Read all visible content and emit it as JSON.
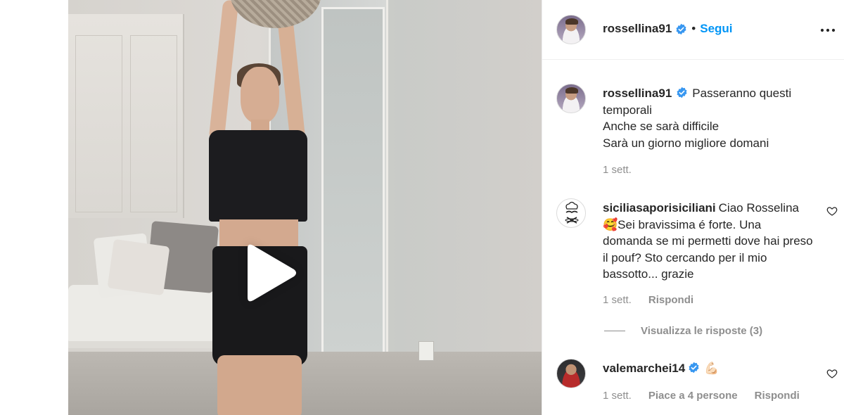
{
  "post": {
    "username": "rossellina91",
    "separator": "•",
    "follow_label": "Segui"
  },
  "caption": {
    "username": "rossellina91",
    "text_line1": "Passeranno questi temporali",
    "text_line2": "Anche se sarà difficile",
    "text_line3": "Sarà un giorno migliore domani",
    "time": "1 sett."
  },
  "comments": [
    {
      "username": "siciliasaporisiciliani",
      "text": "Ciao Rosselina",
      "emoji": "🥰",
      "text2": "Sei bravissima é forte. Una domanda se mi permetti dove hai preso il pouf? Sto cercando per il mio bassotto... grazie",
      "time": "1 sett.",
      "reply_label": "Rispondi",
      "view_replies_label": "Visualizza le risposte (3)"
    },
    {
      "username": "valemarchei14",
      "emoji": "💪🏻",
      "time": "1 sett.",
      "likes_label": "Piace a 4 persone",
      "reply_label": "Rispondi"
    }
  ],
  "icons": {
    "verified": "verified-badge-icon",
    "more": "more-options-icon",
    "heart": "heart-outline-icon",
    "play": "play-icon"
  },
  "colors": {
    "accent": "#0095f6",
    "verified": "#3897f0",
    "text": "#262626",
    "muted": "#8e8e8e"
  }
}
